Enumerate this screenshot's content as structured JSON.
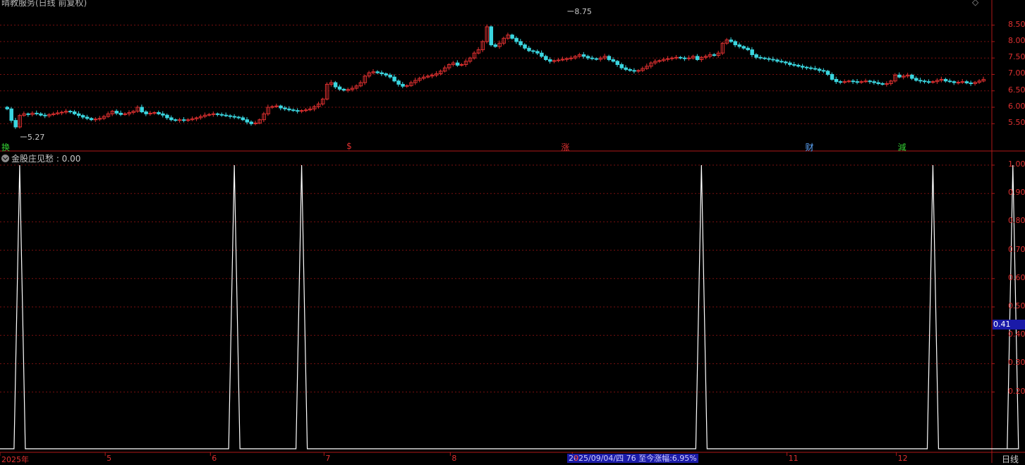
{
  "window": {
    "title": "晴教服务(日线 前复权)",
    "period_label": "日线"
  },
  "indicator": {
    "title": "金股庄见愁 : 0.00",
    "current_value_label": "0.41"
  },
  "status": {
    "date_info": "2025/09/04/四 76 至今涨幅:6.95%"
  },
  "tags": [
    {
      "text": "换",
      "color": "#33cc33",
      "pos": 0
    },
    {
      "text": "$",
      "color": "#e03030",
      "pos": 82
    },
    {
      "text": "涨",
      "color": "#e03030",
      "pos": 133
    },
    {
      "text": "财",
      "color": "#5ea8ff",
      "pos": 191
    },
    {
      "text": "減",
      "color": "#33cc33",
      "pos": 213
    }
  ],
  "colors": {
    "up": "#e03030",
    "down": "#3ad6e0",
    "grid": "#7a1010",
    "axis": "#b01818",
    "line": "#ffffff"
  },
  "chart_data": [
    {
      "type": "candlestick",
      "title": "",
      "ylim": [
        5.2,
        8.9
      ],
      "yticks": [
        "8.50",
        "8.00",
        "7.50",
        "7.00",
        "6.50",
        "6.00",
        "5.50"
      ],
      "annotations": [
        {
          "text": "5.27",
          "pos": 3
        },
        {
          "text": "8.75",
          "pos": 133
        }
      ],
      "close": [
        5.95,
        5.6,
        5.4,
        5.75,
        5.8,
        5.78,
        5.82,
        5.8,
        5.76,
        5.74,
        5.78,
        5.8,
        5.83,
        5.85,
        5.88,
        5.86,
        5.8,
        5.75,
        5.7,
        5.66,
        5.62,
        5.64,
        5.66,
        5.72,
        5.8,
        5.88,
        5.82,
        5.78,
        5.8,
        5.84,
        5.88,
        6.0,
        5.86,
        5.8,
        5.82,
        5.84,
        5.8,
        5.76,
        5.68,
        5.62,
        5.6,
        5.62,
        5.6,
        5.62,
        5.65,
        5.68,
        5.72,
        5.76,
        5.78,
        5.8,
        5.78,
        5.76,
        5.74,
        5.72,
        5.7,
        5.68,
        5.62,
        5.55,
        5.5,
        5.52,
        5.62,
        5.8,
        6.0,
        6.02,
        6.04,
        5.98,
        5.95,
        5.92,
        5.9,
        5.88,
        5.9,
        5.92,
        5.95,
        6.02,
        6.1,
        6.25,
        6.7,
        6.75,
        6.62,
        6.55,
        6.52,
        6.54,
        6.58,
        6.65,
        6.75,
        6.95,
        7.05,
        7.08,
        7.05,
        7.02,
        6.98,
        6.92,
        6.8,
        6.7,
        6.64,
        6.66,
        6.75,
        6.82,
        6.88,
        6.92,
        6.95,
        6.98,
        7.02,
        7.1,
        7.2,
        7.3,
        7.35,
        7.28,
        7.3,
        7.4,
        7.5,
        7.65,
        7.75,
        8.0,
        8.45,
        7.9,
        7.85,
        7.95,
        8.1,
        8.2,
        8.1,
        8.0,
        7.9,
        7.8,
        7.72,
        7.7,
        7.65,
        7.55,
        7.45,
        7.4,
        7.42,
        7.44,
        7.46,
        7.48,
        7.5,
        7.55,
        7.6,
        7.55,
        7.5,
        7.48,
        7.46,
        7.5,
        7.55,
        7.45,
        7.4,
        7.3,
        7.2,
        7.15,
        7.12,
        7.1,
        7.12,
        7.18,
        7.25,
        7.35,
        7.4,
        7.42,
        7.46,
        7.48,
        7.5,
        7.52,
        7.5,
        7.48,
        7.5,
        7.55,
        7.45,
        7.52,
        7.55,
        7.6,
        7.58,
        7.65,
        7.95,
        8.05,
        8.0,
        7.9,
        7.85,
        7.8,
        7.75,
        7.6,
        7.52,
        7.5,
        7.48,
        7.46,
        7.44,
        7.4,
        7.38,
        7.35,
        7.3,
        7.28,
        7.25,
        7.22,
        7.2,
        7.18,
        7.16,
        7.12,
        7.1,
        7.0,
        6.85,
        6.78,
        6.76,
        6.78,
        6.8,
        6.78,
        6.76,
        6.78,
        6.8,
        6.78,
        6.75,
        6.72,
        6.7,
        6.72,
        6.8,
        6.98,
        6.92,
        6.95,
        6.98,
        6.88,
        6.82,
        6.8,
        6.78,
        6.76,
        6.78,
        6.82,
        6.85,
        6.8,
        6.78,
        6.75,
        6.76,
        6.78,
        6.74,
        6.72,
        6.76,
        6.8,
        6.85
      ]
    },
    {
      "type": "line",
      "title": "金股庄见愁",
      "ylim": [
        0,
        1.0
      ],
      "yticks": [
        "1.00",
        "0.90",
        "0.80",
        "0.70",
        "0.60",
        "0.50",
        "0.40",
        "0.30",
        "0.20"
      ],
      "x_labels": [
        "2025年",
        "5",
        "6",
        "7",
        "8",
        "9",
        "11",
        "12"
      ],
      "x_label_pos": [
        0,
        25,
        50,
        77,
        107,
        136,
        187,
        213
      ],
      "spike_pos": [
        3,
        54,
        70,
        165,
        220,
        239
      ]
    }
  ]
}
